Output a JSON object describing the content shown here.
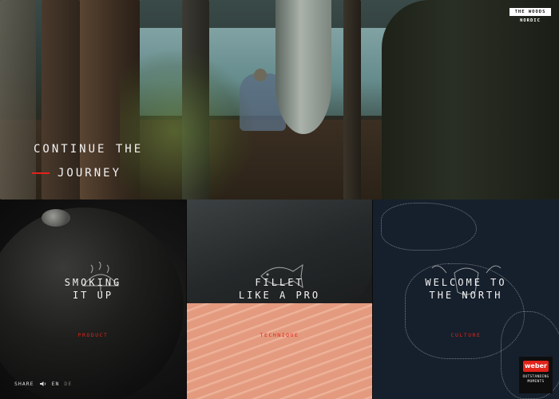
{
  "brand": {
    "logo_top": "THE WOODS",
    "logo_sub": "NORDIC"
  },
  "hero": {
    "cta_line1": "CONTINUE THE",
    "cta_line2": "JOURNEY"
  },
  "tiles": [
    {
      "title_line1": "SMOKING",
      "title_line2": "IT UP",
      "category": "PRODUCT"
    },
    {
      "title_line1": "FILLET",
      "title_line2": "LIKE A PRO",
      "category": "TECHNIQUE"
    },
    {
      "title_line1": "WELCOME TO",
      "title_line2": "THE NORTH",
      "category": "CULTURE"
    }
  ],
  "footer": {
    "share_label": "SHARE",
    "sound_icon": "speaker-icon",
    "lang_active": "EN",
    "lang_inactive": "DE"
  },
  "weber": {
    "badge": "weber",
    "tag_line1": "OUTSTANDING",
    "tag_line2": "MOMENTS"
  },
  "colors": {
    "accent": "#e2231a",
    "text": "#f4f4f4"
  }
}
